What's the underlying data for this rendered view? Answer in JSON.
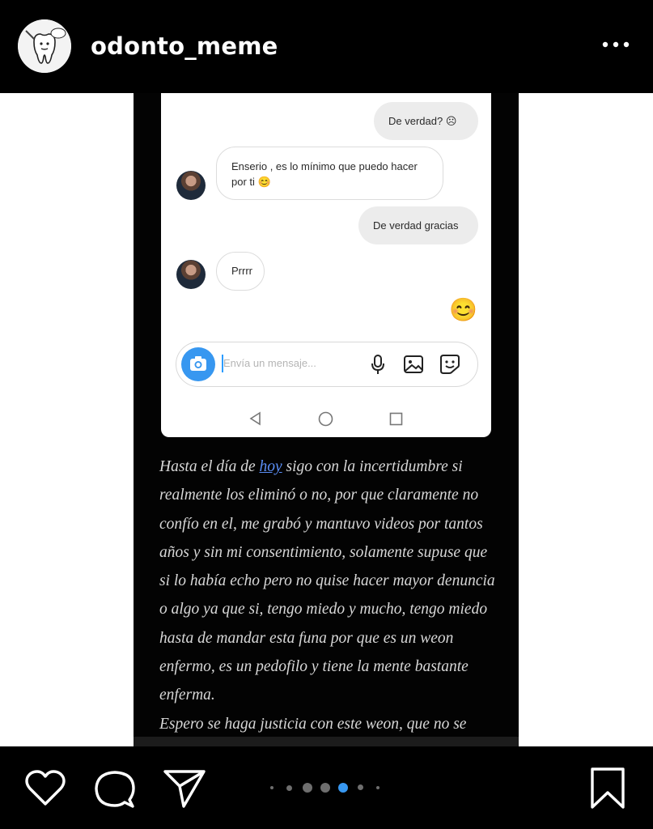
{
  "header": {
    "username": "odonto_meme",
    "avatar_icon": "tooth-cartoon-icon",
    "more_icon": "more-horizontal-icon"
  },
  "chat": {
    "messages": [
      {
        "side": "out",
        "text": "De verdad? ☹"
      },
      {
        "side": "in",
        "text": "Enserio , es lo mínimo que puedo hacer por ti 😊"
      },
      {
        "side": "out",
        "text": "De verdad gracias"
      },
      {
        "side": "in",
        "text": "Prrrr"
      }
    ],
    "emoji_reply": "😊",
    "composer_placeholder": "Envía un mensaje..."
  },
  "story": {
    "text_before_link": "Hasta el día de ",
    "link_text": "hoy",
    "text_after_link": " sigo con la incertidumbre si realmente los eliminó o no, por que claramente no confío en el, me grabó y mantuvo videos por tantos años y sin mi consentimiento, solamente supuse que si lo había echo pero no quise hacer mayor denuncia o algo ya que si, tengo miedo y mucho, tengo miedo hasta de mandar esta funa por que es un weon enfermo, es un pedofilo y tiene la mente bastante enferma.",
    "text_last": "Espero se haga justicia con este weon, que no se"
  },
  "carousel": {
    "count": 7,
    "active_index": 4
  },
  "colors": {
    "accent": "#3797f0",
    "link": "#5b8ff7",
    "background": "#000000"
  }
}
